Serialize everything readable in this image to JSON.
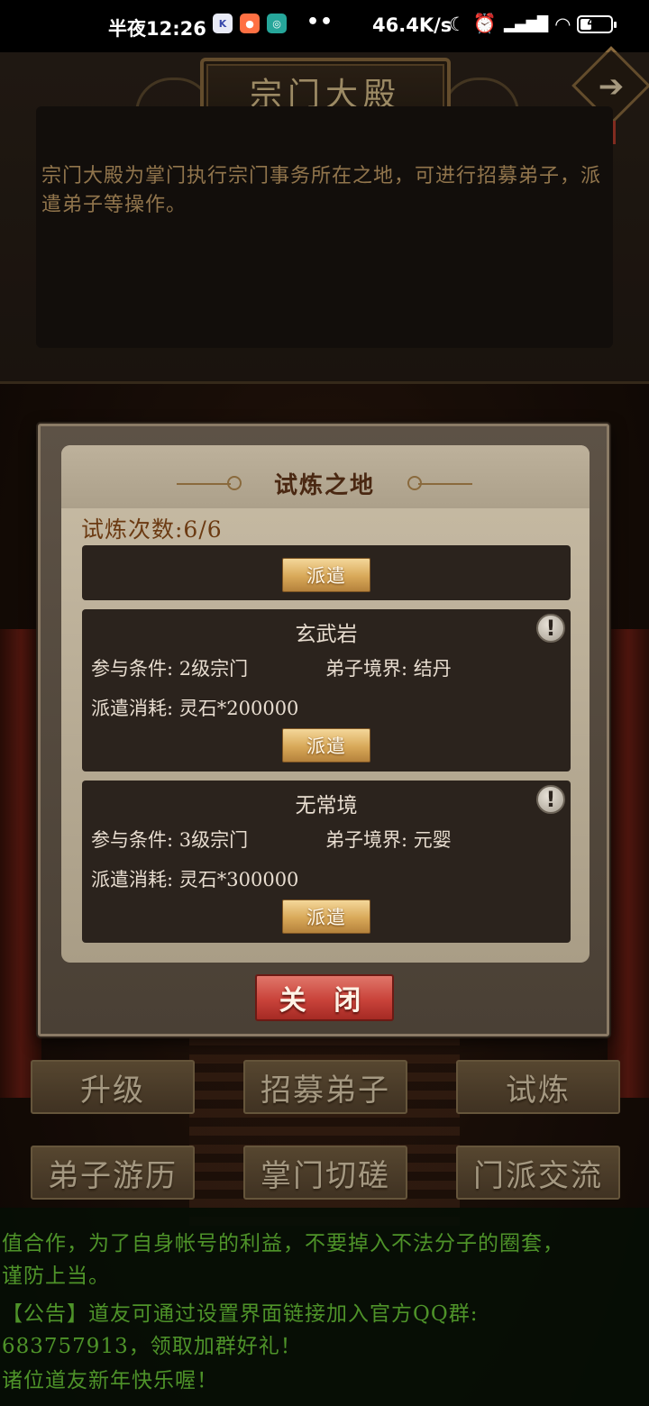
{
  "status_bar": {
    "time": "半夜12:26",
    "net_speed": "46.4K/s",
    "battery": "44",
    "battery_level": 0.44,
    "dots": "••"
  },
  "header": {
    "title": "宗门大殿",
    "description": "宗门大殿为掌门执行宗门事务所在之地，可进行招募弟子，派遣弟子等操作。"
  },
  "dialog": {
    "title": "试炼之地",
    "count_label": "试炼次数:6/6",
    "dispatch_label": "派遣",
    "close_label": "关 闭",
    "trials": [
      {
        "name": "玄武岩",
        "condition": "参与条件: 2级宗门",
        "realm": "弟子境界: 结丹",
        "cost": "派遣消耗: 灵石*200000",
        "info": "!"
      },
      {
        "name": "无常境",
        "condition": "参与条件: 3级宗门",
        "realm": "弟子境界: 元婴",
        "cost": "派遣消耗: 灵石*300000",
        "info": "!"
      }
    ]
  },
  "menu": {
    "upgrade": "升级",
    "recruit": "招募弟子",
    "trial": "试炼",
    "travel": "弟子游历",
    "spar": "掌门切磋",
    "exchange": "门派交流"
  },
  "chat": {
    "line1": "值合作，为了自身帐号的利益，不要掉入不法分子的圈套，",
    "line2": "谨防上当。",
    "line3": "【公告】道友可通过设置界面链接加入官方QQ群:",
    "line4": "683757913，领取加群好礼！",
    "line5": "诸位道友新年快乐喔！"
  }
}
